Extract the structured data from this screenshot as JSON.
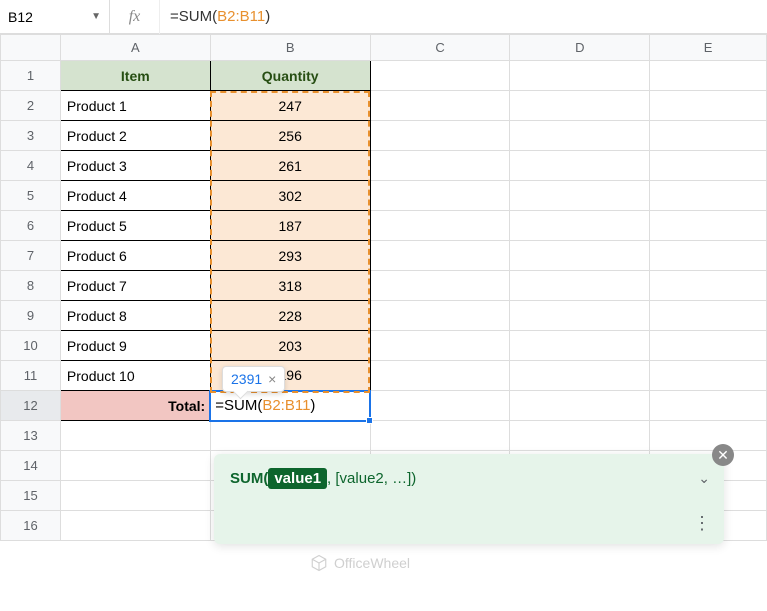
{
  "name_box": {
    "value": "B12"
  },
  "fx_label": "fx",
  "formula": {
    "prefix": "=SUM",
    "open": "(",
    "range": "B2:B11",
    "close": ")"
  },
  "columns": [
    "A",
    "B",
    "C",
    "D",
    "E"
  ],
  "rows": [
    "1",
    "2",
    "3",
    "4",
    "5",
    "6",
    "7",
    "8",
    "9",
    "10",
    "11",
    "12",
    "13",
    "14",
    "15",
    "16"
  ],
  "headers": {
    "a": "Item",
    "b": "Quantity"
  },
  "data": [
    {
      "item": "Product 1",
      "qty": "247"
    },
    {
      "item": "Product 2",
      "qty": "256"
    },
    {
      "item": "Product 3",
      "qty": "261"
    },
    {
      "item": "Product 4",
      "qty": "302"
    },
    {
      "item": "Product 5",
      "qty": "187"
    },
    {
      "item": "Product 6",
      "qty": "293"
    },
    {
      "item": "Product 7",
      "qty": "318"
    },
    {
      "item": "Product 8",
      "qty": "228"
    },
    {
      "item": "Product 9",
      "qty": "203"
    },
    {
      "item": "Product 10",
      "qty": "196"
    }
  ],
  "total": {
    "label": "Total:",
    "formula_prefix": "=SUM",
    "formula_open": "(",
    "formula_range": "B2:B11",
    "formula_close": ")"
  },
  "tooltip": {
    "value": "2391",
    "close": "×"
  },
  "helper": {
    "fn": "SUM",
    "open": "(",
    "arg1": "value1",
    "rest": ", [value2, …])",
    "close_badge": "✕"
  },
  "watermark": "OfficeWheel"
}
